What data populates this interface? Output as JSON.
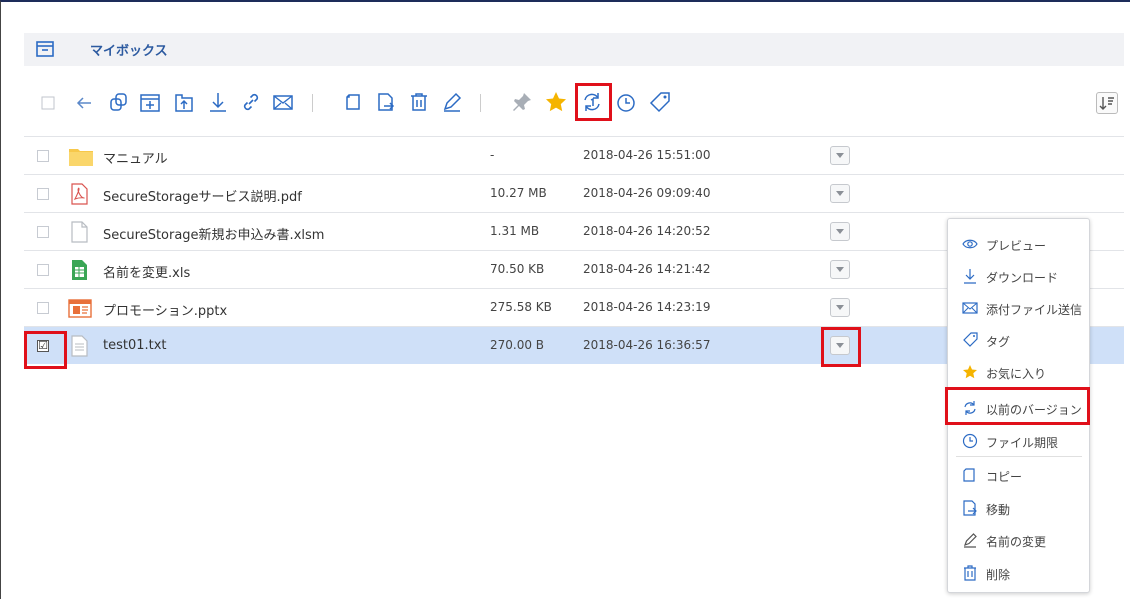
{
  "breadcrumb": {
    "label": "マイボックス",
    "icon": "archive-box-icon"
  },
  "colors": {
    "accent": "#2c5aa0",
    "highlight": "#e0101a",
    "selected_row": "#cfe0f8",
    "icon_gray": "#8a8f96",
    "star": "#f5b400",
    "folder": "#f7c84a"
  },
  "toolbar": {
    "icons": [
      "select-all-checkbox",
      "back-icon",
      "copy-icon",
      "new-folder-icon",
      "upload-icon",
      "download-icon",
      "link-icon",
      "mail-icon",
      "duplicate-icon",
      "move-icon",
      "delete-icon",
      "rename-icon",
      "pin-icon",
      "favorite-star-icon",
      "version-history-icon",
      "expiry-clock-icon",
      "tag-icon"
    ],
    "sort_icon": "sort-icon"
  },
  "files": [
    {
      "name": "マニュアル",
      "size": "-",
      "date": "2018-04-26 15:51:00",
      "type": "folder",
      "checked": false
    },
    {
      "name": "SecureStorageサービス説明.pdf",
      "size": "10.27 MB",
      "date": "2018-04-26 09:09:40",
      "type": "pdf",
      "checked": false
    },
    {
      "name": "SecureStorage新規お申込み書.xlsm",
      "size": "1.31 MB",
      "date": "2018-04-26 14:20:52",
      "type": "file",
      "checked": false
    },
    {
      "name": "名前を変更.xls",
      "size": "70.50 KB",
      "date": "2018-04-26 14:21:42",
      "type": "spreadsheet",
      "checked": false
    },
    {
      "name": "プロモーション.pptx",
      "size": "275.58 KB",
      "date": "2018-04-26 14:23:19",
      "type": "presentation",
      "checked": false
    },
    {
      "name": "test01.txt",
      "size": "270.00 B",
      "date": "2018-04-26 16:36:57",
      "type": "text",
      "checked": true
    }
  ],
  "checkbox_mark": "☑",
  "context_menu": {
    "items": [
      {
        "label": "プレビュー",
        "icon": "eye-icon"
      },
      {
        "label": "ダウンロード",
        "icon": "download-icon"
      },
      {
        "label": "添付ファイル送信",
        "icon": "mail-icon"
      },
      {
        "label": "タグ",
        "icon": "tag-icon"
      },
      {
        "label": "お気に入り",
        "icon": "star-icon"
      },
      {
        "label": "以前のバージョン",
        "icon": "version-history-icon"
      },
      {
        "label": "ファイル期限",
        "icon": "clock-icon"
      },
      {
        "label": "コピー",
        "icon": "copy-icon"
      },
      {
        "label": "移動",
        "icon": "move-icon"
      },
      {
        "label": "名前の変更",
        "icon": "pencil-icon"
      },
      {
        "label": "削除",
        "icon": "trash-icon"
      }
    ]
  }
}
